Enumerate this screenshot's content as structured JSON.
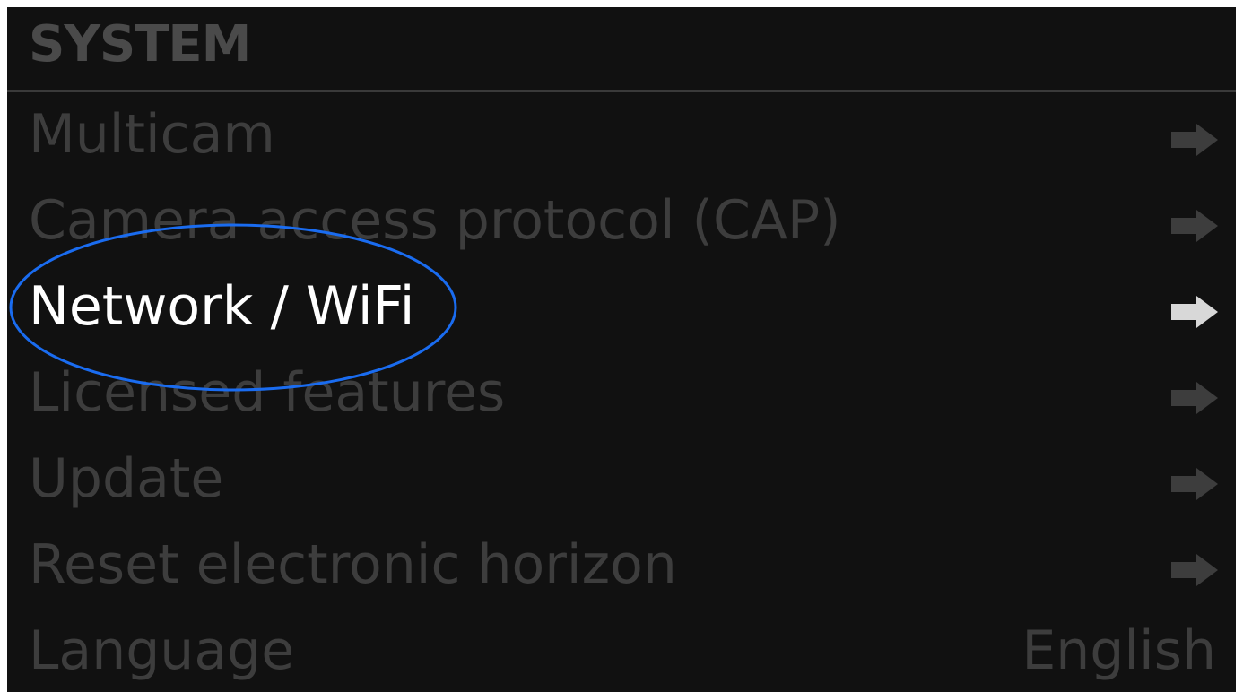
{
  "header": {
    "title": "SYSTEM"
  },
  "menu": {
    "items": [
      {
        "label": "Multicam",
        "trailing": "arrow-right-icon"
      },
      {
        "label": "Camera access protocol (CAP)",
        "trailing": "arrow-right-icon"
      },
      {
        "label": "Network / WiFi",
        "trailing": "arrow-right-icon",
        "selected": true
      },
      {
        "label": "Licensed features",
        "trailing": "arrow-right-icon"
      },
      {
        "label": "Update",
        "trailing": "arrow-right-icon"
      },
      {
        "label": "Reset electronic horizon",
        "trailing": "arrow-right-icon"
      },
      {
        "label": "Language",
        "value": "English"
      }
    ]
  },
  "colors": {
    "background": "#111111",
    "dim_text": "#3d3d3d",
    "selected_text": "#ffffff",
    "highlight_ring": "#1a6cf0"
  }
}
